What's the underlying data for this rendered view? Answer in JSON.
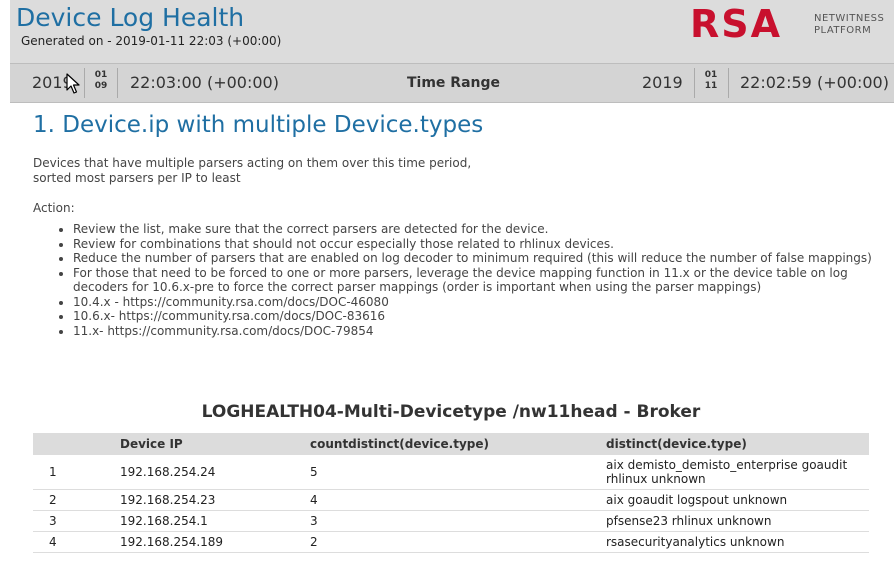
{
  "header": {
    "title": "Device Log Health",
    "generated": "Generated on - 2019-01-11 22:03 (+00:00)",
    "logo_main": "RSA",
    "logo_sub_1": "NETWITNESS",
    "logo_sub_2": "PLATFORM",
    "logo_color": "#c8102e",
    "title_color": "#1f6fa3"
  },
  "timebar": {
    "start_year": "2019",
    "start_month": "01",
    "start_day": "09",
    "start_time": "22:03:00 (+00:00)",
    "range_label": "Time Range",
    "end_year": "2019",
    "end_month": "01",
    "end_day": "11",
    "end_time": "22:02:59 (+00:00)"
  },
  "section": {
    "heading": "1. Device.ip with multiple Device.types",
    "desc_line1": "Devices that have multiple parsers acting on them over this time period,",
    "desc_line2": "sorted most parsers per IP to least",
    "action_label": "Action:",
    "actions": [
      "Review the list, make sure that the correct parsers are detected for the device.",
      "Review for combinations that should not occur especially those related to rhlinux devices.",
      "Reduce the number of parsers that are enabled on log decoder to minimum required (this will reduce the number of false mappings)",
      "For those that need to be forced to one or more parsers, leverage the device mapping function in 11.x or the device table on log decoders for 10.6.x-pre to force the correct parser mappings (order is important when using the parser mappings)",
      "10.4.x - https://community.rsa.com/docs/DOC-46080",
      "10.6.x- https://community.rsa.com/docs/DOC-83616",
      "11.x- https://community.rsa.com/docs/DOC-79854"
    ]
  },
  "table": {
    "title": "LOGHEALTH04-Multi-Devicetype /nw11head - Broker",
    "columns": [
      "",
      "Device IP",
      "countdistinct(device.type)",
      "distinct(device.type)"
    ],
    "rows": [
      [
        "1",
        "192.168.254.24",
        "5",
        "aix demisto_demisto_enterprise goaudit rhlinux unknown"
      ],
      [
        "2",
        "192.168.254.23",
        "4",
        "aix goaudit logspout unknown"
      ],
      [
        "3",
        "192.168.254.1",
        "3",
        "pfsense23 rhlinux unknown"
      ],
      [
        "4",
        "192.168.254.189",
        "2",
        "rsasecurityanalytics unknown"
      ]
    ]
  }
}
